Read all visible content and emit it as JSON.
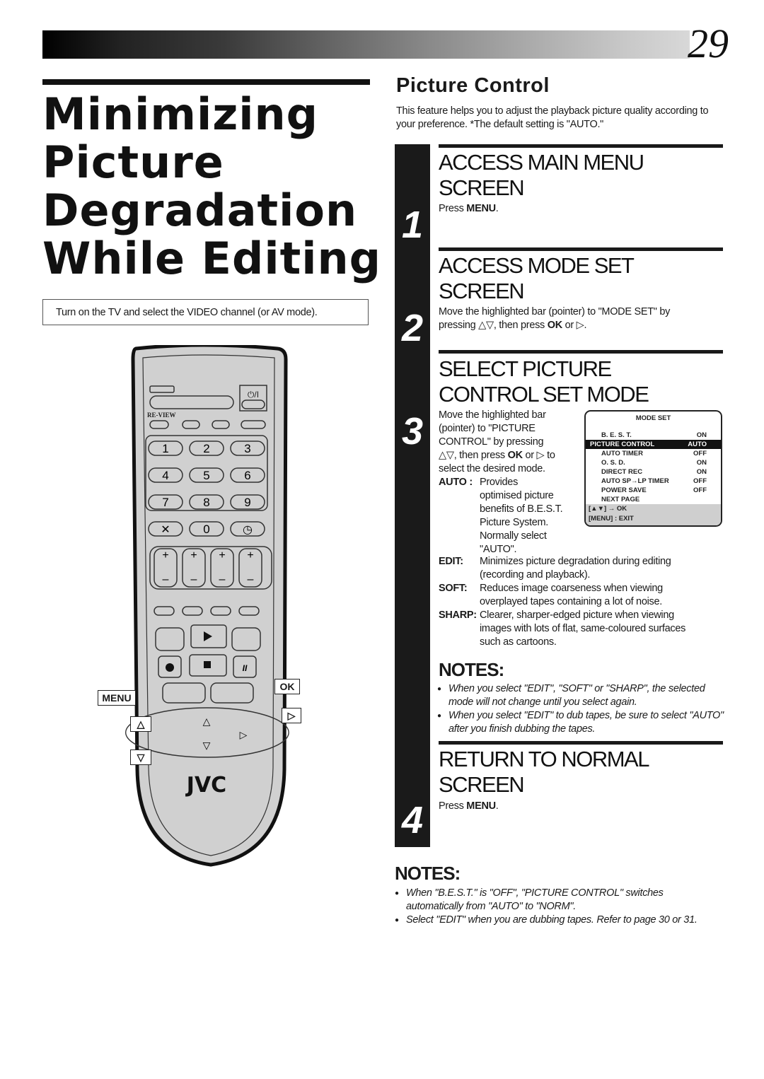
{
  "header": {
    "page_number": "29"
  },
  "title": {
    "lines": [
      "Minimizing",
      "Picture",
      "Degradation",
      "While Editing"
    ]
  },
  "prerequisite": "Turn on the TV and select the VIDEO channel (or AV mode).",
  "section": {
    "title": "Picture Control",
    "description": "This feature helps you to adjust the playback picture quality according to your preference. *The default setting is \"AUTO.\""
  },
  "steps": [
    {
      "number": "1",
      "heading_lines": [
        "ACCESS MAIN MENU",
        "SCREEN"
      ],
      "body_prefix": "Press ",
      "body_key": "MENU",
      "body_suffix": "."
    },
    {
      "number": "2",
      "heading_lines": [
        "ACCESS MODE SET",
        "SCREEN"
      ],
      "body_line1": "Move the highlighted bar (pointer) to \"MODE SET\" by",
      "body_line2_prefix": "pressing △▽, then press ",
      "body_key": "OK",
      "body_line2_suffix": " or ▷."
    },
    {
      "number": "3",
      "heading_lines": [
        "SELECT PICTURE",
        "CONTROL SET MODE"
      ],
      "body_lines": [
        "Move the highlighted bar",
        "(pointer) to \"PICTURE",
        "CONTROL\" by pressing"
      ],
      "body_line4_prefix": "△▽, then press ",
      "body_key": "OK",
      "body_line4_suffix": " or ▷ to",
      "body_line5": "select the desired mode.",
      "auto_key": "AUTO",
      "auto_lines": [
        "Provides",
        "optimised picture",
        "benefits of B.E.S.T.",
        "Picture System.",
        "Normally select",
        "\"AUTO\"."
      ],
      "modes": [
        {
          "key": "EDIT:",
          "lines": [
            "Minimizes picture degradation during editing",
            "(recording and playback)."
          ]
        },
        {
          "key": "SOFT:",
          "lines": [
            "Reduces image coarseness when viewing",
            "overplayed tapes containing a lot of noise."
          ]
        },
        {
          "key": "SHARP:",
          "lines": [
            "Clearer, sharper-edged picture when viewing",
            "images with lots of flat, same-coloured surfaces",
            "such as cartoons."
          ]
        }
      ]
    },
    {
      "number": "4",
      "heading_lines": [
        "RETURN TO NORMAL",
        "SCREEN"
      ],
      "body_prefix": "Press ",
      "body_key": "MENU",
      "body_suffix": "."
    }
  ],
  "osd": {
    "title": "MODE SET",
    "rows": [
      {
        "label": "B. E. S. T.",
        "value": "ON",
        "selected": false
      },
      {
        "label": "PICTURE CONTROL",
        "value": "AUTO",
        "selected": true
      },
      {
        "label": "AUTO TIMER",
        "value": "OFF",
        "selected": false
      },
      {
        "label": "O. S. D.",
        "value": "ON",
        "selected": false
      },
      {
        "label": "DIRECT REC",
        "value": "ON",
        "selected": false
      },
      {
        "label": "AUTO SP→LP TIMER",
        "value": "OFF",
        "selected": false
      },
      {
        "label": "POWER SAVE",
        "value": "OFF",
        "selected": false
      },
      {
        "label": "NEXT PAGE",
        "value": "",
        "selected": false
      }
    ],
    "footer_line1": "[▲▼] → OK",
    "footer_line2": "[MENU] : EXIT"
  },
  "notes_inner": {
    "heading": "NOTES:",
    "items": [
      "When you select \"EDIT\", \"SOFT\" or \"SHARP\", the selected mode will not change until you select again.",
      "When you select \"EDIT\" to dub tapes, be sure to select \"AUTO\" after you finish dubbing the tapes."
    ]
  },
  "notes_bottom": {
    "heading": "NOTES:",
    "items": [
      "When \"B.E.S.T.\" is \"OFF\", \"PICTURE CONTROL\" switches automatically from \"AUTO\" to \"NORM\".",
      "Select \"EDIT\" when you are dubbing tapes. Refer to page 30 or 31."
    ]
  },
  "remote": {
    "brand": "JVC",
    "review_label": "RE-VIEW",
    "power_label": "⏻/I",
    "digits": [
      "1",
      "2",
      "3",
      "4",
      "5",
      "6",
      "7",
      "8",
      "9",
      "0"
    ],
    "callouts": {
      "menu": "MENU",
      "ok": "OK",
      "up": "△",
      "down": "▽",
      "right": "▷"
    }
  }
}
